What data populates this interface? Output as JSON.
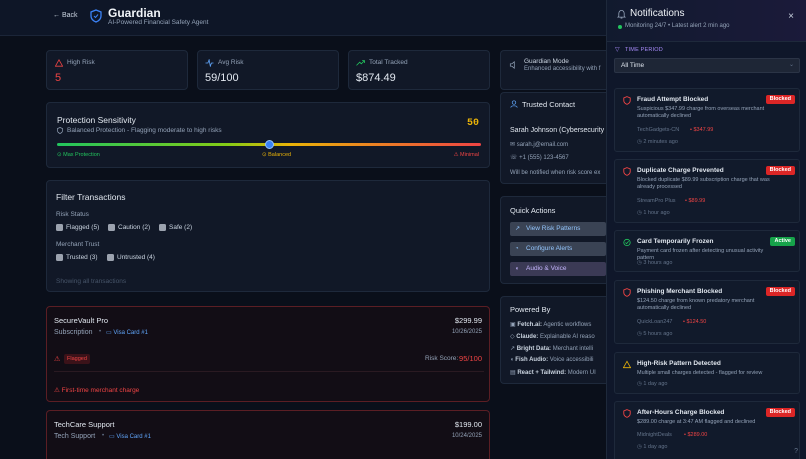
{
  "header": {
    "back_label": "← Back",
    "title": "Guardian",
    "subtitle": "AI-Powered Financial Safety Agent"
  },
  "stats": [
    {
      "label": "High Risk",
      "value": "5",
      "icon": "warning-triangle-icon"
    },
    {
      "label": "Avg Risk",
      "value": "59/100",
      "icon": "activity-icon"
    },
    {
      "label": "Total Tracked",
      "value": "$874.49",
      "icon": "trending-up-icon"
    }
  ],
  "guardian_mode": {
    "title": "Guardian Mode",
    "subtitle": "Enhanced accessibility with f"
  },
  "sensitivity": {
    "title": "Protection Sensitivity",
    "value": "50",
    "level": 50,
    "description": "Balanced Protection - Flagging moderate to high risks",
    "left_label": "Max Protection",
    "mid_label": "Balanced",
    "right_label": "Minimal"
  },
  "trusted_contact": {
    "title": "Trusted Contact",
    "name": "Sarah Johnson (Cybersecurity",
    "email": "sarah.j@email.com",
    "phone": "+1 (555) 123-4567",
    "note": "Will be notified when risk score ex"
  },
  "filters": {
    "title": "Filter Transactions",
    "risk_status_label": "Risk Status",
    "risk_options": [
      "Flagged (5)",
      "Caution (2)",
      "Safe (2)"
    ],
    "merchant_trust_label": "Merchant Trust",
    "trust_options": [
      "Trusted (3)",
      "Untrusted (4)"
    ],
    "showing": "Showing all transactions"
  },
  "quick_actions": {
    "title": "Quick Actions",
    "buttons": [
      "View Risk Patterns",
      "Configure Alerts",
      "Audio & Voice"
    ]
  },
  "powered_by": {
    "title": "Powered By",
    "items": [
      {
        "name": "Fetch.ai:",
        "desc": "Agentic workflows"
      },
      {
        "name": "Claude:",
        "desc": "Explainable AI reaso"
      },
      {
        "name": "Bright Data:",
        "desc": "Merchant intelli"
      },
      {
        "name": "Fish Audio:",
        "desc": "Voice accessibili"
      },
      {
        "name": "React + Tailwind:",
        "desc": "Modern UI"
      }
    ]
  },
  "transactions": [
    {
      "merchant": "SecureVault Pro",
      "category": "Subscription",
      "card": "Visa Card #1",
      "amount": "$299.99",
      "date": "10/26/2025",
      "status": "Flagged",
      "risk_label": "Risk Score:",
      "risk_score": "95/100",
      "warning": "First-time merchant charge"
    },
    {
      "merchant": "TechCare Support",
      "category": "Tech Support",
      "card": "Visa Card #1",
      "amount": "$199.00",
      "date": "10/24/2025"
    }
  ],
  "notifications_panel": {
    "title": "Notifications",
    "subtitle": "Monitoring 24/7 • Latest alert 2 min ago",
    "time_period_label": "TIME PERIOD",
    "time_period_value": "All Time",
    "items": [
      {
        "title": "Fraud Attempt Blocked",
        "badge": "Blocked",
        "desc": "Suspicious $347.99 charge from overseas merchant automatically declined",
        "merchant": "TechGadgets-CN",
        "amount": "$347.99",
        "time": "2 minutes ago",
        "icon": "shield-icon"
      },
      {
        "title": "Duplicate Charge Prevented",
        "badge": "Blocked",
        "desc": "Blocked duplicate $89.99 subscription charge that was already processed",
        "merchant": "StreamPro Plus",
        "amount": "$89.99",
        "time": "1 hour ago",
        "icon": "shield-icon"
      },
      {
        "title": "Card Temporarily Frozen",
        "badge": "Active",
        "desc": "Payment card frozen after detecting unusual activity pattern",
        "time": "3 hours ago",
        "icon": "check-circle-icon"
      },
      {
        "title": "Phishing Merchant Blocked",
        "badge": "Blocked",
        "desc": "$124.50 charge from known predatory merchant automatically declined",
        "merchant": "QuickLoan247",
        "amount": "$124.50",
        "time": "5 hours ago",
        "icon": "shield-icon"
      },
      {
        "title": "High-Risk Pattern Detected",
        "desc": "Multiple small charges detected - flagged for review",
        "time": "1 day ago",
        "icon": "warning-triangle-icon"
      },
      {
        "title": "After-Hours Charge Blocked",
        "badge": "Blocked",
        "desc": "$289.00 charge at 3:47 AM flagged and declined",
        "merchant": "MidnightDeals",
        "amount": "$289.00",
        "time": "1 day ago",
        "icon": "shield-icon"
      }
    ]
  },
  "colors": {
    "danger": "#ef4444",
    "active": "#22c55e",
    "accent": "#3b82f6",
    "warning": "#eab308"
  }
}
